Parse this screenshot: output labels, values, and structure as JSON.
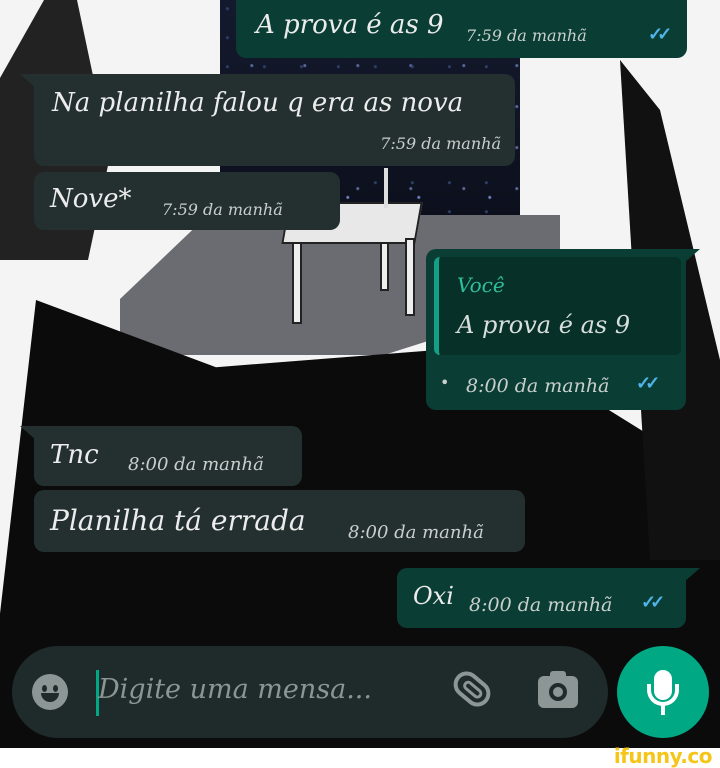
{
  "messages": [
    {
      "text": "A prova é as 9",
      "time": "7:59 da manhã",
      "direction": "out",
      "status": "read"
    },
    {
      "text": "Na planilha falou q era as nova",
      "time": "7:59 da manhã",
      "direction": "in"
    },
    {
      "text": "Nove*",
      "time": "7:59 da manhã",
      "direction": "in"
    },
    {
      "quote_author": "Você",
      "quote_text": "A prova é as 9",
      "time": "8:00 da manhã",
      "direction": "out",
      "status": "read",
      "bullet": "•"
    },
    {
      "text": "Tnc",
      "time": "8:00 da manhã",
      "direction": "in"
    },
    {
      "text": "Planilha tá errada",
      "time": "8:00 da manhã",
      "direction": "in"
    },
    {
      "text": "Oxi",
      "time": "8:00 da manhã",
      "direction": "out",
      "status": "read"
    }
  ],
  "composer": {
    "placeholder": "Digite uma mensa...",
    "emoji_icon": "emoji-icon",
    "attach_icon": "paperclip-icon",
    "camera_icon": "camera-icon",
    "mic_icon": "microphone-icon"
  },
  "read_ticks": "✓✓",
  "watermark": "ifunny.co",
  "colors": {
    "incoming_bubble": "#23302f",
    "outgoing_bubble": "#0a3e35",
    "quote_accent": "#14a085",
    "quote_author": "#2fbf9c",
    "read_ticks": "#4fb4e8",
    "mic_button": "#00a884",
    "input_bar": "#1f2b2b"
  }
}
